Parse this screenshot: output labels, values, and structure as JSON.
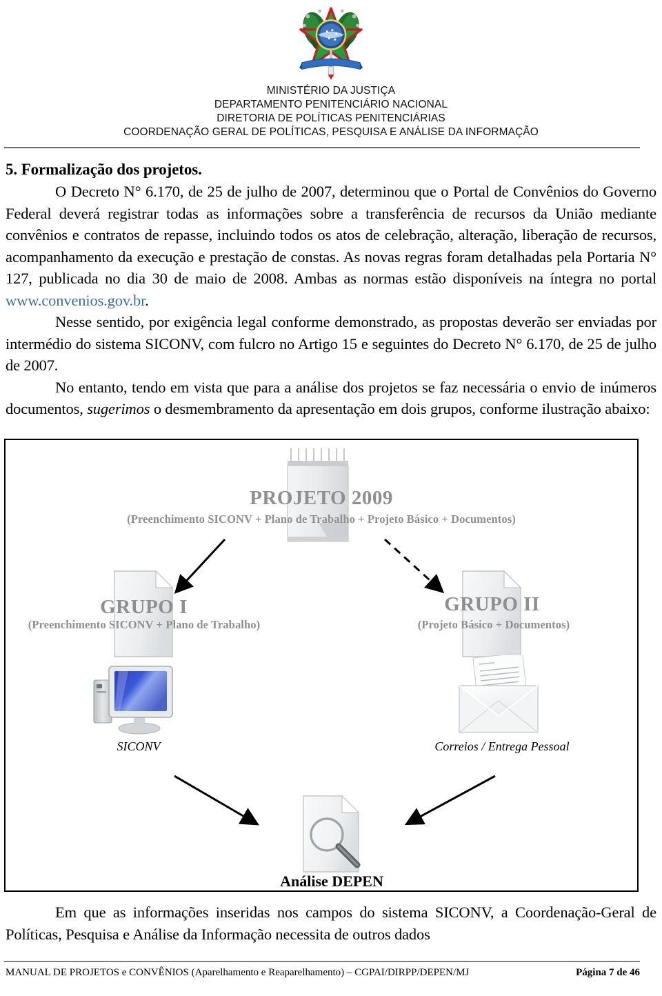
{
  "header": {
    "crest_icon": "brazil-coat-of-arms",
    "org_lines": [
      "MINISTÉRIO DA JUSTIÇA",
      "DEPARTAMENTO PENITENCIÁRIO NACIONAL",
      "DIRETORIA DE POLÍTICAS PENITENCIÁRIAS",
      "COORDENAÇÃO GERAL DE POLÍTICAS, PESQUISA E ANÁLISE DA INFORMAÇÃO"
    ]
  },
  "body": {
    "section_title": "5. Formalização dos projetos.",
    "paragraph_1_before_link": "O Decreto N° 6.170, de 25 de julho de 2007, determinou que o Portal de Convênios do Governo Federal deverá registrar todas as informações sobre a transferência de recursos da União mediante convênios e contratos de repasse, incluindo todos os atos de celebração, alteração, liberação de recursos, acompanhamento da execução e prestação de constas. As novas regras foram detalhadas pela Portaria N° 127, publicada no dia 30 de maio de 2008. Ambas as normas estão disponíveis na íntegra no portal ",
    "paragraph_1_link": "www.convenios.gov.br",
    "paragraph_1_after_link": ".",
    "paragraph_2": "Nesse sentido, por exigência legal conforme demonstrado, as propostas deverão ser enviadas por intermédio do  sistema SICONV,  com fulcro no Artigo 15 e seguintes do Decreto N° 6.170, de 25 de julho de 2007.",
    "paragraph_3_part_a": "No entanto, tendo em vista que para a análise dos projetos se faz necessária o envio de inúmeros documentos, ",
    "paragraph_3_italic": "sugerimos",
    "paragraph_3_part_b": " o desmembramento da apresentação em dois grupos, conforme ilustração abaixo:",
    "paragraph_4": "Em que as informações inseridas nos campos do sistema SICONV, a Coordenação-Geral de Políticas, Pesquisa e Análise da Informação necessita de outros dados"
  },
  "diagram": {
    "accent_gray": "#8f8f8f",
    "nodes": {
      "projeto": {
        "title": "PROJETO 2009",
        "subtitle": "(Preenchimento SICONV + Plano de Trabalho + Projeto Básico + Documentos)",
        "icon": "notepad-icon"
      },
      "grupo_1": {
        "title": "GRUPO I",
        "subtitle": "(Preenchimento SICONV + Plano de Trabalho)",
        "icon": "document-page-icon"
      },
      "grupo_2": {
        "title": "GRUPO II",
        "subtitle": "(Projeto Básico + Documentos)",
        "icon": "document-page-icon"
      },
      "siconv": {
        "caption": "SICONV",
        "icon": "desktop-computer-icon"
      },
      "correios": {
        "caption": "Correios / Entrega Pessoal",
        "icon": "open-envelope-icon"
      },
      "analise": {
        "caption": "Análise DEPEN",
        "icon": "document-magnifier-icon"
      }
    },
    "connectors": [
      {
        "name": "projeto-to-grupo1",
        "style": "solid",
        "direction": "down-left"
      },
      {
        "name": "projeto-to-grupo2",
        "style": "dashed",
        "direction": "down-right"
      },
      {
        "name": "siconv-to-analise",
        "style": "solid",
        "direction": "down-right"
      },
      {
        "name": "correios-to-analise",
        "style": "solid",
        "direction": "down-left"
      }
    ]
  },
  "footer": {
    "left": "MANUAL DE  PROJETOS e CONVÊNIOS (Aparelhamento e Reaparelhamento) – CGPAI/DIRPP/DEPEN/MJ",
    "right": "Página 7 de 46"
  }
}
